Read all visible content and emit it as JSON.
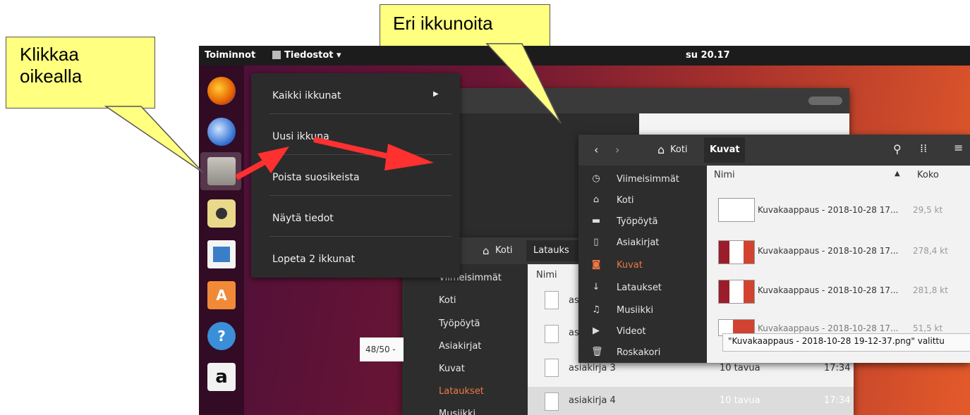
{
  "callouts": {
    "right_click": "Klikkaa\noikealla",
    "windows": "Eri ikkunoita"
  },
  "topbar": {
    "activities": "Toiminnot",
    "app_menu": "Tiedostot ▾",
    "clock": "su 20.17"
  },
  "dock": {
    "icons": [
      "firefox-icon",
      "thunderbird-icon",
      "files-icon",
      "rhythmbox-icon",
      "writer-icon",
      "software-icon",
      "help-icon",
      "amazon-icon"
    ]
  },
  "context_menu": {
    "items": [
      "Kaikki ikkunat",
      "Uusi ikkuna",
      "Poista suosikeista",
      "Näytä tiedot",
      "Lopeta 2 ikkunat"
    ]
  },
  "back_window": {
    "page_indicator": "48/50 -",
    "path": {
      "home": "Koti",
      "current": "Latauks"
    },
    "column_name": "Nimi",
    "sidebar": [
      "Viimeisimmät",
      "Koti",
      "Työpöytä",
      "Asiakirjat",
      "Kuvat",
      "Lataukset",
      "Musiikki"
    ],
    "files": [
      {
        "name": "as",
        "size": "",
        "time": ""
      },
      {
        "name": "as",
        "size": "",
        "time": ""
      },
      {
        "name": "asiakirja 3",
        "size": "10 tavua",
        "time": "17:34"
      },
      {
        "name": "asiakirja 4",
        "size": "10 tavua",
        "time": "17:34"
      }
    ]
  },
  "front_window": {
    "path": {
      "home": "Koti",
      "current": "Kuvat"
    },
    "columns": {
      "name": "Nimi",
      "size": "Koko"
    },
    "sidebar": [
      "Viimeisimmät",
      "Koti",
      "Työpöytä",
      "Asiakirjat",
      "Kuvat",
      "Lataukset",
      "Musiikki",
      "Videot",
      "Roskakori"
    ],
    "files": [
      {
        "name": "Kuvakaappaus - 2018-10-28 17...",
        "size": "29,5 kt"
      },
      {
        "name": "Kuvakaappaus - 2018-10-28 17...",
        "size": "278,4 kt"
      },
      {
        "name": "Kuvakaappaus - 2018-10-28 17...",
        "size": "281,8 kt"
      },
      {
        "name": "Kuvakaappaus - 2018-10-28 17...",
        "size": "51,5 kt"
      }
    ],
    "status": "\"Kuvakaappaus - 2018-10-28 19-12-37.png\" valittu"
  },
  "colors": {
    "callout": "#ffff80",
    "arrow": "#ff3030",
    "accent": "#e95420"
  }
}
